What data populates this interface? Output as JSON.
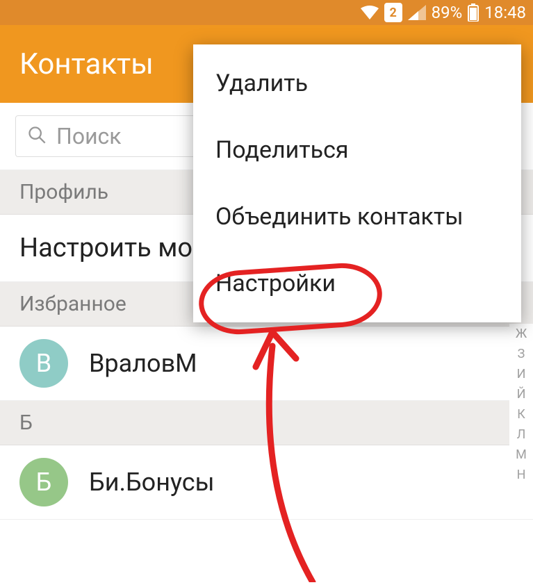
{
  "status_bar": {
    "sim_label": "2",
    "battery_percent": "89%",
    "time": "18:48"
  },
  "app": {
    "title": "Контакты"
  },
  "search": {
    "placeholder": "Поиск"
  },
  "sections": {
    "profile": "Профиль",
    "favorites": "Избранное"
  },
  "profile_row": "Настроить мо",
  "contacts": {
    "vralovm": {
      "initial": "В",
      "name": "ВраловМ"
    },
    "bi_bonusy": {
      "initial": "Б",
      "name": "Би.Бонусы"
    }
  },
  "letter_header": "Б",
  "index": [
    "Ж",
    "З",
    "И",
    "Й",
    "К",
    "Л",
    "М",
    "Н"
  ],
  "menu": {
    "delete": "Удалить",
    "share": "Поделиться",
    "merge": "Объединить контакты",
    "settings": "Настройки"
  }
}
